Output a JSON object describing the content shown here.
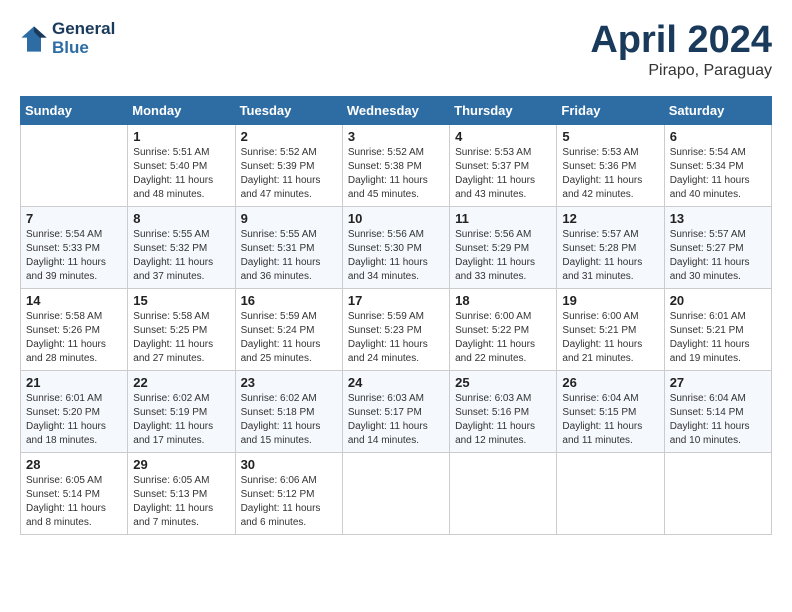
{
  "header": {
    "logo_line1": "General",
    "logo_line2": "Blue",
    "month": "April 2024",
    "location": "Pirapo, Paraguay"
  },
  "days_of_week": [
    "Sunday",
    "Monday",
    "Tuesday",
    "Wednesday",
    "Thursday",
    "Friday",
    "Saturday"
  ],
  "weeks": [
    [
      {
        "day": "",
        "info": ""
      },
      {
        "day": "1",
        "info": "Sunrise: 5:51 AM\nSunset: 5:40 PM\nDaylight: 11 hours\nand 48 minutes."
      },
      {
        "day": "2",
        "info": "Sunrise: 5:52 AM\nSunset: 5:39 PM\nDaylight: 11 hours\nand 47 minutes."
      },
      {
        "day": "3",
        "info": "Sunrise: 5:52 AM\nSunset: 5:38 PM\nDaylight: 11 hours\nand 45 minutes."
      },
      {
        "day": "4",
        "info": "Sunrise: 5:53 AM\nSunset: 5:37 PM\nDaylight: 11 hours\nand 43 minutes."
      },
      {
        "day": "5",
        "info": "Sunrise: 5:53 AM\nSunset: 5:36 PM\nDaylight: 11 hours\nand 42 minutes."
      },
      {
        "day": "6",
        "info": "Sunrise: 5:54 AM\nSunset: 5:34 PM\nDaylight: 11 hours\nand 40 minutes."
      }
    ],
    [
      {
        "day": "7",
        "info": "Sunrise: 5:54 AM\nSunset: 5:33 PM\nDaylight: 11 hours\nand 39 minutes."
      },
      {
        "day": "8",
        "info": "Sunrise: 5:55 AM\nSunset: 5:32 PM\nDaylight: 11 hours\nand 37 minutes."
      },
      {
        "day": "9",
        "info": "Sunrise: 5:55 AM\nSunset: 5:31 PM\nDaylight: 11 hours\nand 36 minutes."
      },
      {
        "day": "10",
        "info": "Sunrise: 5:56 AM\nSunset: 5:30 PM\nDaylight: 11 hours\nand 34 minutes."
      },
      {
        "day": "11",
        "info": "Sunrise: 5:56 AM\nSunset: 5:29 PM\nDaylight: 11 hours\nand 33 minutes."
      },
      {
        "day": "12",
        "info": "Sunrise: 5:57 AM\nSunset: 5:28 PM\nDaylight: 11 hours\nand 31 minutes."
      },
      {
        "day": "13",
        "info": "Sunrise: 5:57 AM\nSunset: 5:27 PM\nDaylight: 11 hours\nand 30 minutes."
      }
    ],
    [
      {
        "day": "14",
        "info": "Sunrise: 5:58 AM\nSunset: 5:26 PM\nDaylight: 11 hours\nand 28 minutes."
      },
      {
        "day": "15",
        "info": "Sunrise: 5:58 AM\nSunset: 5:25 PM\nDaylight: 11 hours\nand 27 minutes."
      },
      {
        "day": "16",
        "info": "Sunrise: 5:59 AM\nSunset: 5:24 PM\nDaylight: 11 hours\nand 25 minutes."
      },
      {
        "day": "17",
        "info": "Sunrise: 5:59 AM\nSunset: 5:23 PM\nDaylight: 11 hours\nand 24 minutes."
      },
      {
        "day": "18",
        "info": "Sunrise: 6:00 AM\nSunset: 5:22 PM\nDaylight: 11 hours\nand 22 minutes."
      },
      {
        "day": "19",
        "info": "Sunrise: 6:00 AM\nSunset: 5:21 PM\nDaylight: 11 hours\nand 21 minutes."
      },
      {
        "day": "20",
        "info": "Sunrise: 6:01 AM\nSunset: 5:21 PM\nDaylight: 11 hours\nand 19 minutes."
      }
    ],
    [
      {
        "day": "21",
        "info": "Sunrise: 6:01 AM\nSunset: 5:20 PM\nDaylight: 11 hours\nand 18 minutes."
      },
      {
        "day": "22",
        "info": "Sunrise: 6:02 AM\nSunset: 5:19 PM\nDaylight: 11 hours\nand 17 minutes."
      },
      {
        "day": "23",
        "info": "Sunrise: 6:02 AM\nSunset: 5:18 PM\nDaylight: 11 hours\nand 15 minutes."
      },
      {
        "day": "24",
        "info": "Sunrise: 6:03 AM\nSunset: 5:17 PM\nDaylight: 11 hours\nand 14 minutes."
      },
      {
        "day": "25",
        "info": "Sunrise: 6:03 AM\nSunset: 5:16 PM\nDaylight: 11 hours\nand 12 minutes."
      },
      {
        "day": "26",
        "info": "Sunrise: 6:04 AM\nSunset: 5:15 PM\nDaylight: 11 hours\nand 11 minutes."
      },
      {
        "day": "27",
        "info": "Sunrise: 6:04 AM\nSunset: 5:14 PM\nDaylight: 11 hours\nand 10 minutes."
      }
    ],
    [
      {
        "day": "28",
        "info": "Sunrise: 6:05 AM\nSunset: 5:14 PM\nDaylight: 11 hours\nand 8 minutes."
      },
      {
        "day": "29",
        "info": "Sunrise: 6:05 AM\nSunset: 5:13 PM\nDaylight: 11 hours\nand 7 minutes."
      },
      {
        "day": "30",
        "info": "Sunrise: 6:06 AM\nSunset: 5:12 PM\nDaylight: 11 hours\nand 6 minutes."
      },
      {
        "day": "",
        "info": ""
      },
      {
        "day": "",
        "info": ""
      },
      {
        "day": "",
        "info": ""
      },
      {
        "day": "",
        "info": ""
      }
    ]
  ]
}
